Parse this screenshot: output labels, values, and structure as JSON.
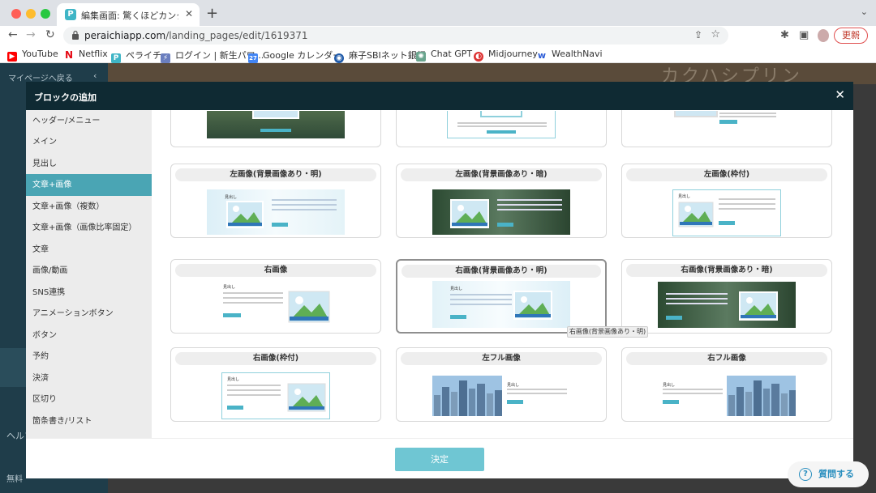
{
  "browser": {
    "tab_title": "編集画面: 驚くほどカンタン！無料",
    "tab_favicon": "P",
    "url_host": "peraichiapp.com",
    "url_path": "/landing_pages/edit/1619371",
    "renew_label": "更新"
  },
  "bookmarks": [
    {
      "label": "YouTube",
      "icon": "youtube-icon",
      "color": "#ff0000"
    },
    {
      "label": "Netflix",
      "icon": "netflix-icon",
      "color": "#e50914"
    },
    {
      "label": "ペライチ",
      "icon": "peraichi-icon",
      "color": "#3fb5c6"
    },
    {
      "label": "ログイン | 新生パワ...",
      "icon": "power-icon",
      "color": "#6b7fbf"
    },
    {
      "label": "Google カレンダー",
      "icon": "calendar-icon",
      "color": "#4285f4"
    },
    {
      "label": "麻子SBIネット銀行",
      "icon": "bank-icon",
      "color": "#1f5aa8"
    },
    {
      "label": "Chat GPT",
      "icon": "chatgpt-icon",
      "color": "#6aa58e"
    },
    {
      "label": "Midjourney",
      "icon": "midjourney-icon",
      "color": "#d33"
    },
    {
      "label": "WealthNavi",
      "icon": "wealthnavi-icon",
      "color": "#2a5bd7"
    }
  ],
  "app": {
    "back_label": "マイページへ戻る",
    "hero_text": "カクハシプリン",
    "help_label": "ヘルプ",
    "free_label": "無料"
  },
  "modal": {
    "title": "ブロックの追加",
    "decide_label": "決定",
    "tooltip": "右画像(背景画像あり・明)",
    "categories": [
      "ヘッダー/メニュー",
      "メイン",
      "見出し",
      "文章+画像",
      "文章+画像（複数）",
      "文章+画像（画像比率固定）",
      "文章",
      "画像/動画",
      "SNS連携",
      "アニメーションボタン",
      "ボタン",
      "予約",
      "決済",
      "区切り",
      "箇条書き/リスト"
    ],
    "active_category": "文章+画像",
    "cards": [
      {
        "label": "左画像(背景画像あり・明)"
      },
      {
        "label": "左画像(背景画像あり・暗)"
      },
      {
        "label": "左画像(枠付)"
      },
      {
        "label": "右画像"
      },
      {
        "label": "右画像(背景画像あり・明)"
      },
      {
        "label": "右画像(背景画像あり・暗)"
      },
      {
        "label": "右画像(枠付)"
      },
      {
        "label": "左フル画像"
      },
      {
        "label": "右フル画像"
      }
    ]
  },
  "ask_button": "質問する"
}
